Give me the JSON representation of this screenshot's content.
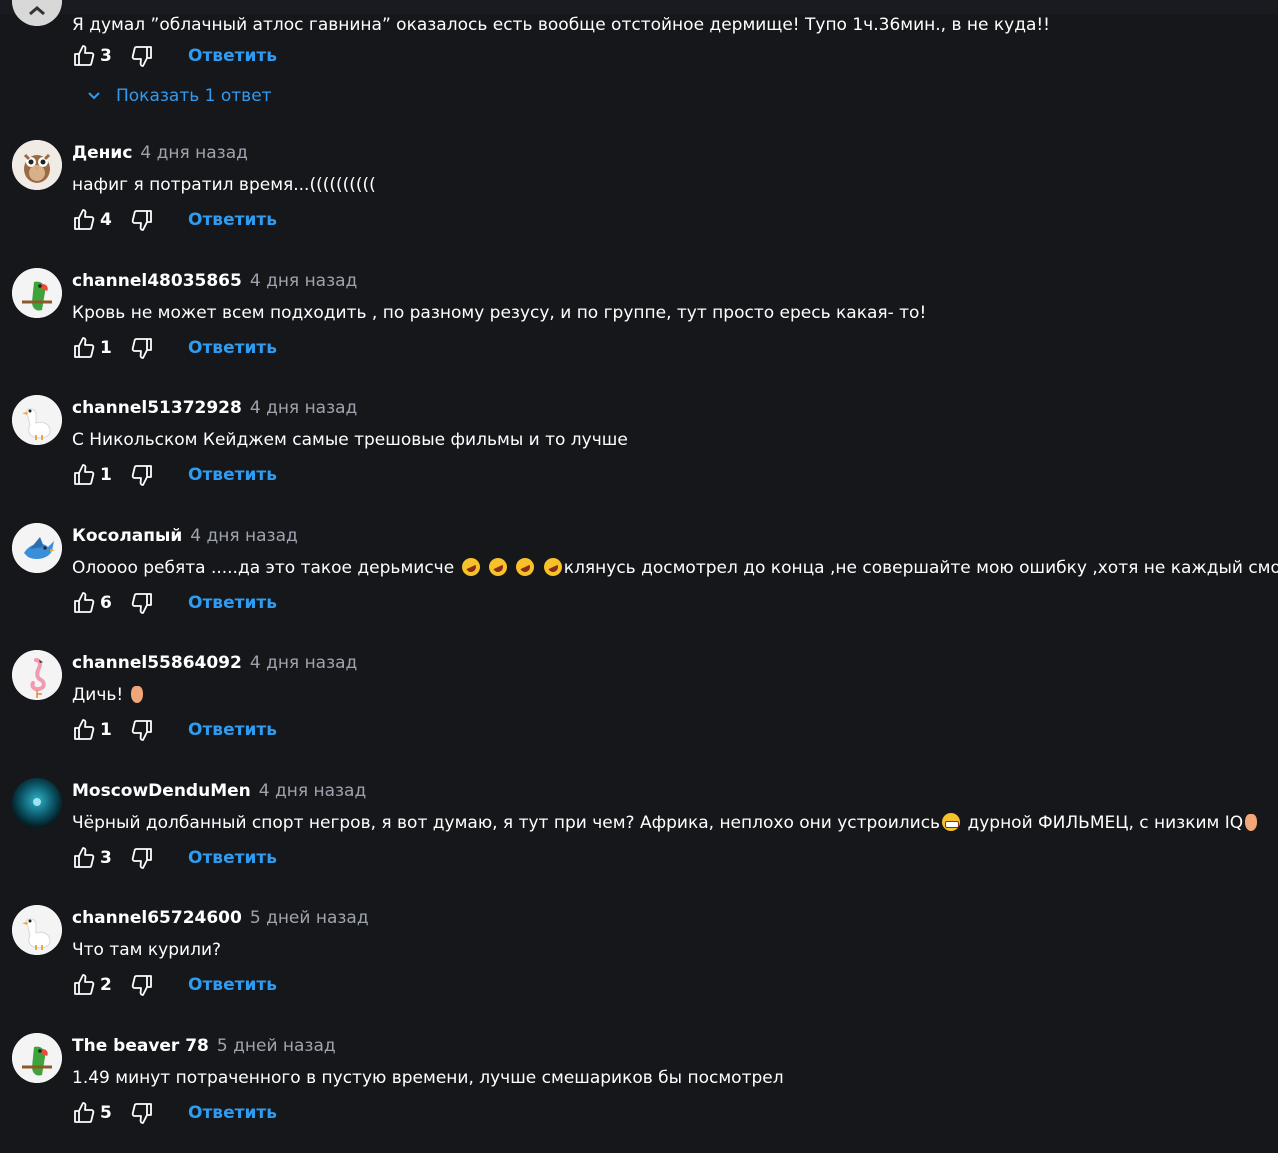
{
  "reply_label": "Ответить",
  "show_replies_label": "Показать 1 ответ",
  "comments": [
    {
      "author": "",
      "time": "",
      "text": "Я думал ”облачный атлос гавнина” оказалось есть вообще отстойное дермище! Тупо 1ч.36мин., в не куда!!",
      "likes": "3",
      "avatar": "partial-avatar"
    },
    {
      "author": "Денис",
      "time": "4 дня назад",
      "text": "нафиг я потратил время...((((((((((",
      "likes": "4",
      "avatar": "owl-icon"
    },
    {
      "author": "channel48035865",
      "time": "4 дня назад",
      "text": "Кровь не может всем подходить , по разному резусу, и по группе, тут просто ересь какая- то!",
      "likes": "1",
      "avatar": "parrot-icon"
    },
    {
      "author": "channel51372928",
      "time": "4 дня назад",
      "text": "С Никольском Кейджем самые трешовые фильмы и то лучше",
      "likes": "1",
      "avatar": "goose-icon"
    },
    {
      "author": "Косолапый",
      "time": "4 дня назад",
      "text_parts": [
        "Олоооо ребята .....да это такое дерьмисче ",
        "клянусь досмотрел до конца ,не совершайте мою ошибку ,хотя не каждый сможет"
      ],
      "emoji": "rolling-on-floor-laughing-emoji",
      "likes": "6",
      "avatar": "bird-icon"
    },
    {
      "author": "channel55864092",
      "time": "4 дня назад",
      "text": "Дичь! ",
      "emoji": "thumbs-down-emoji",
      "likes": "1",
      "avatar": "flamingo-icon"
    },
    {
      "author": "MoscowDenduMen",
      "time": "4 дня назад",
      "text_parts": [
        "Чёрный долбанный спорт негров, я вот думаю, я тут при чем? Африка, неплохо они устроились",
        " дурной ФИЛЬМЕЦ, с низким IQ"
      ],
      "emoji": "grimacing-emoji",
      "emoji2": "thumbs-down-emoji",
      "likes": "3",
      "avatar": "dark-photo-avatar"
    },
    {
      "author": "channel65724600",
      "time": "5 дней назад",
      "text": "Что там курили?",
      "likes": "2",
      "avatar": "goose-icon"
    },
    {
      "author": "The beaver 78",
      "time": "5 дней назад",
      "text": "1.49 минут потраченного в пустую времени, лучше смешариков бы посмотрел",
      "likes": "5",
      "avatar": "parrot-icon"
    }
  ],
  "colors": {
    "background": "#15171b",
    "accent": "#2f9cf0",
    "muted": "#9ea3ad"
  }
}
